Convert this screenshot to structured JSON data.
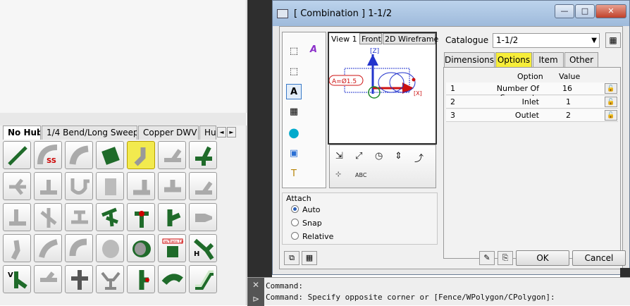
{
  "palette": {
    "tabs": [
      "No Hub",
      "1/4 Bend/Long Sweep",
      "Copper DWV",
      "Hu"
    ],
    "active_tab": "No Hub",
    "scroll_left": "◄",
    "scroll_right": "►",
    "tile_labels": {
      "ss": "SS",
      "wtrans": "w/Trans Cp",
      "h": "H",
      "v": "V"
    }
  },
  "dialog": {
    "title": "[ Combination ]  1-1/2",
    "minimize": "—",
    "maximize": "□",
    "close": "✕",
    "view_tabs": [
      "View 1",
      "Front",
      "2D Wireframe"
    ],
    "view_labels": {
      "z": "[Z]",
      "a": "A=Ø1.5",
      "x": "[X]"
    },
    "viewtools_label": "ABC",
    "catalogue_label": "Catalogue",
    "catalogue_value": "1-1/2",
    "tabs": [
      "Dimensions",
      "Options",
      "Item",
      "Other"
    ],
    "active_tab": "Options",
    "options_header": {
      "option": "Option",
      "value": "Value"
    },
    "options": [
      {
        "num": "1",
        "option": "Number Of Segments",
        "value": "16"
      },
      {
        "num": "2",
        "option": "Inlet",
        "value": "1"
      },
      {
        "num": "3",
        "option": "Outlet",
        "value": "2"
      }
    ],
    "attach": {
      "label": "Attach",
      "options": [
        "Auto",
        "Snap",
        "Relative"
      ],
      "selected": "Auto"
    },
    "ok": "OK",
    "cancel": "Cancel"
  },
  "command": {
    "lines": [
      "Command:",
      "Command: Specify opposite corner or [Fence/WPolygon/CPolygon]:"
    ]
  },
  "colors": {
    "pipe_green": "#1f6b2a",
    "highlight_yellow": "#f7ee3a",
    "axis_blue": "#2233cc",
    "axis_red": "#cc1111"
  }
}
